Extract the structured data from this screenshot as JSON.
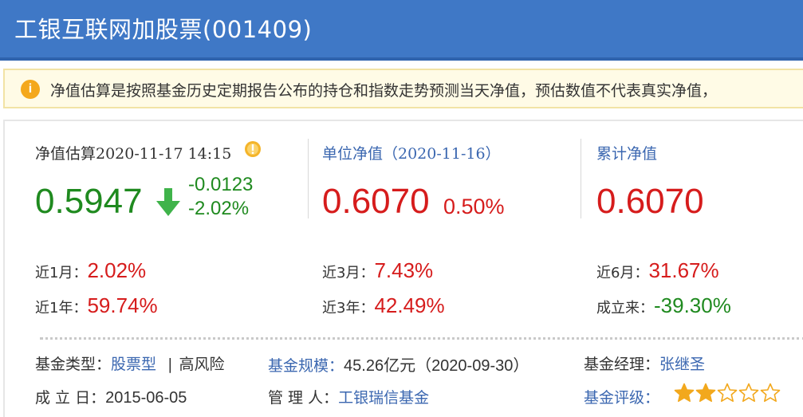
{
  "header": {
    "title": "工银互联网加股票(001409)"
  },
  "notice": {
    "text": "净值估算是按照基金历史定期报告公布的持仓和指数走势预测当天净值，预估数值不代表真实净值，"
  },
  "estimate": {
    "label": "净值估算2020-11-17 14:15",
    "value": "0.5947",
    "change": "-0.0123",
    "change_pct": "-2.02%"
  },
  "unit_nav": {
    "label": "单位净值（2020-11-16）",
    "value": "0.6070",
    "change_pct": "0.50%"
  },
  "cumulative_nav": {
    "label": "累计净值",
    "value": "0.6070"
  },
  "returns": [
    {
      "label": "近1月：",
      "value": "2.02%"
    },
    {
      "label": "近3月：",
      "value": "7.43%"
    },
    {
      "label": "近6月：",
      "value": "31.67%"
    },
    {
      "label": "近1年：",
      "value": "59.74%"
    },
    {
      "label": "近3年：",
      "value": "42.49%"
    },
    {
      "label": "成立来：",
      "value": "-39.30%"
    }
  ],
  "info": {
    "fund_type_label": "基金类型：",
    "fund_type": "股票型",
    "separator": "|",
    "risk": "高风险",
    "size_label": "基金规模：",
    "size": "45.26亿元（2020-09-30）",
    "manager_label": "基金经理：",
    "manager": "张继圣",
    "inception_label": "成 立 日：",
    "inception": "2015-06-05",
    "custodian_label": "管 理 人：",
    "custodian": "工银瑞信基金",
    "rating_label": "基金评级：",
    "rating_stars": 2,
    "rating_max": 5
  },
  "colors": {
    "header_bg": "#3f78c6",
    "up": "#d61c1c",
    "down": "#1f8a1f",
    "link": "#3b67b0",
    "star": "#f2a81d"
  },
  "icons": {
    "notice": "info-icon",
    "estimate_tip": "warning-icon",
    "trend": "down-arrow-icon",
    "rating": "star-icon"
  }
}
